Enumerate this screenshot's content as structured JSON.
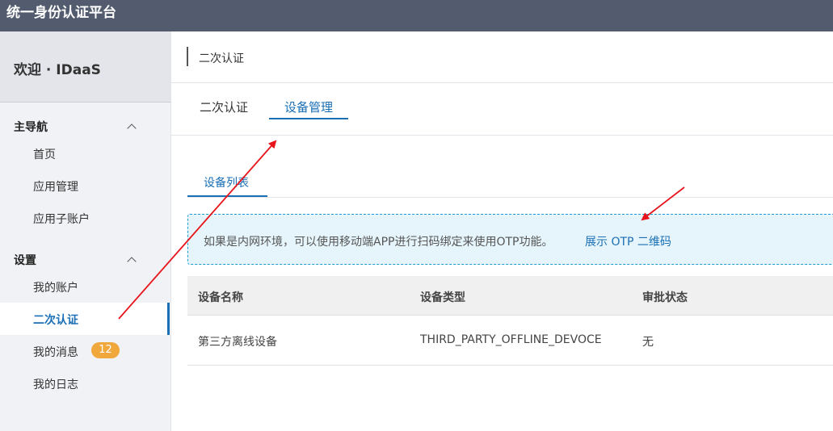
{
  "app": {
    "title": "统一身份认证平台"
  },
  "sidebar": {
    "welcome": "欢迎 · IDaaS",
    "groups": [
      {
        "label": "主导航",
        "items": [
          {
            "label": "首页"
          },
          {
            "label": "应用管理"
          },
          {
            "label": "应用子账户"
          }
        ]
      },
      {
        "label": "设置",
        "items": [
          {
            "label": "我的账户"
          },
          {
            "label": "二次认证",
            "active": true
          },
          {
            "label": "我的消息",
            "badge": "12"
          },
          {
            "label": "我的日志"
          }
        ]
      }
    ]
  },
  "header": {
    "title": "二次认证"
  },
  "tabs": [
    {
      "label": "二次认证"
    },
    {
      "label": "设备管理",
      "active": true
    }
  ],
  "subtabs": [
    {
      "label": "设备列表",
      "active": true
    }
  ],
  "notice": {
    "text": "如果是内网环境，可以使用移动端APP进行扫码绑定来使用OTP功能。",
    "link": "展示 OTP 二维码"
  },
  "table": {
    "headers": [
      "设备名称",
      "设备类型",
      "审批状态"
    ],
    "rows": [
      [
        "第三方离线设备",
        "THIRD_PARTY_OFFLINE_DEVOCE",
        "无"
      ]
    ]
  },
  "colors": {
    "accent": "#1a6fb5",
    "topbar": "#535b6e",
    "badge": "#f0a73c",
    "annotation": "#e8141b"
  },
  "icons": [
    "chevron-up-icon"
  ]
}
